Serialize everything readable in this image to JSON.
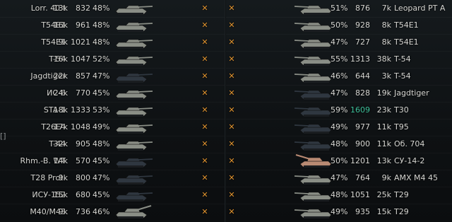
{
  "colors": {
    "background": "#0b0d0f",
    "text": "#d6d6d2",
    "destroyed_marker": "#e0932f",
    "highlight": "#3ec09a",
    "tank_dark": "#2f3740",
    "tank_light": "#8a8e86",
    "tank_orange": "#b98a73"
  },
  "marker_glyph": "✕",
  "side_glyph": "[]",
  "left_team": [
    {
      "name": "Lorr. 40 t",
      "dmg": "13k",
      "exp": "832",
      "win": "48%",
      "icon": "tank-light-icon"
    },
    {
      "name": "T54E1",
      "dmg": "16k",
      "exp": "961",
      "win": "48%",
      "icon": "tank-light-icon"
    },
    {
      "name": "T54E1",
      "dmg": "9k",
      "exp": "1021",
      "win": "48%",
      "icon": "tank-light-icon"
    },
    {
      "name": "T-54",
      "dmg": "16k",
      "exp": "1047",
      "win": "52%",
      "icon": "tank-light-icon"
    },
    {
      "name": "Jagdtiger",
      "dmg": "22k",
      "exp": "857",
      "win": "47%",
      "icon": "tank-dark-icon"
    },
    {
      "name": "ИС-6",
      "dmg": "24k",
      "exp": "770",
      "win": "45%",
      "icon": "tank-light-icon"
    },
    {
      "name": "STA-1",
      "dmg": "18k",
      "exp": "1333",
      "win": "53%",
      "icon": "tank-light-icon"
    },
    {
      "name": "T26E4",
      "dmg": "17k",
      "exp": "1048",
      "win": "49%",
      "icon": "tank-light-icon"
    },
    {
      "name": "T-44",
      "dmg": "32k",
      "exp": "905",
      "win": "48%",
      "icon": "tank-light-icon"
    },
    {
      "name": "Rhm.-B. WT",
      "dmg": "14k",
      "exp": "570",
      "win": "45%",
      "icon": "tank-dark-icon"
    },
    {
      "name": "T28 Prot.",
      "dmg": "9k",
      "exp": "800",
      "win": "47%",
      "icon": "tank-dark-icon"
    },
    {
      "name": "ИСУ-152",
      "dmg": "15k",
      "exp": "680",
      "win": "45%",
      "icon": "tank-dark-icon"
    },
    {
      "name": "M40/M43",
      "dmg": "9k",
      "exp": "736",
      "win": "46%",
      "icon": "spg-light-icon"
    }
  ],
  "right_team": [
    {
      "name": "Leopard PT A",
      "dmg": "7k",
      "exp": "876",
      "win": "51%",
      "icon": "tank-light-icon",
      "highlight": false
    },
    {
      "name": "T54E1",
      "dmg": "8k",
      "exp": "928",
      "win": "50%",
      "icon": "tank-light-icon",
      "highlight": false
    },
    {
      "name": "T54E1",
      "dmg": "8k",
      "exp": "727",
      "win": "47%",
      "icon": "tank-light-icon",
      "highlight": false
    },
    {
      "name": "T-54",
      "dmg": "38k",
      "exp": "1313",
      "win": "55%",
      "icon": "tank-light-icon",
      "highlight": false
    },
    {
      "name": "T-54",
      "dmg": "3k",
      "exp": "644",
      "win": "46%",
      "icon": "tank-light-icon",
      "highlight": false
    },
    {
      "name": "Jagdtiger",
      "dmg": "19k",
      "exp": "828",
      "win": "47%",
      "icon": "tank-dark-icon",
      "highlight": false
    },
    {
      "name": "T30",
      "dmg": "23k",
      "exp": "1609",
      "win": "59%",
      "icon": "tank-dark-icon",
      "highlight": true
    },
    {
      "name": "T95",
      "dmg": "11k",
      "exp": "977",
      "win": "49%",
      "icon": "tank-dark-icon",
      "highlight": false
    },
    {
      "name": "Об. 704",
      "dmg": "11k",
      "exp": "900",
      "win": "48%",
      "icon": "tank-dark-icon",
      "highlight": false
    },
    {
      "name": "СУ-14-2",
      "dmg": "13k",
      "exp": "1201",
      "win": "50%",
      "icon": "spg-orange-icon",
      "highlight": false
    },
    {
      "name": "AMX M4 45",
      "dmg": "9k",
      "exp": "764",
      "win": "47%",
      "icon": "tank-light-icon",
      "highlight": false
    },
    {
      "name": "T29",
      "dmg": "25k",
      "exp": "1051",
      "win": "48%",
      "icon": "tank-light-icon",
      "highlight": false
    },
    {
      "name": "T29",
      "dmg": "15k",
      "exp": "935",
      "win": "49%",
      "icon": "tank-light-icon",
      "highlight": false
    }
  ]
}
